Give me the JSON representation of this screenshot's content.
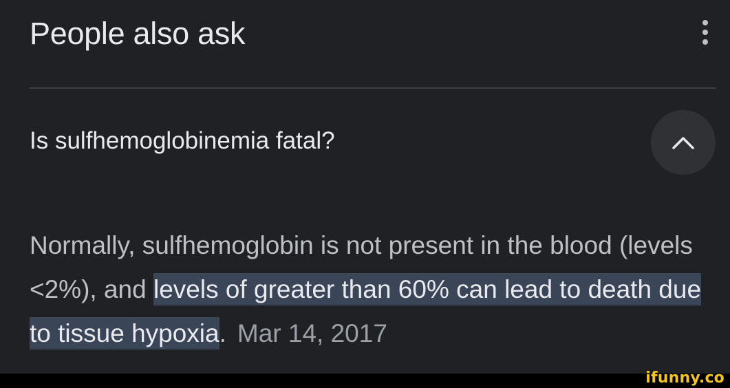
{
  "header": {
    "title": "People also ask",
    "more_icon": "more-vert-icon"
  },
  "question": {
    "text": "Is sulfhemoglobinemia fatal?",
    "toggle_icon": "chevron-up-icon"
  },
  "answer": {
    "text_before": "Normally, sulfhemoglobin is not present in the blood (levels <2%), and ",
    "highlighted": "levels of greater than 60% can lead to death due to tissue hypoxia",
    "text_after": ".",
    "date": "Mar 14, 2017"
  },
  "watermark": {
    "text": "ifunny.co"
  },
  "colors": {
    "background": "#202124",
    "highlight": "#3b4558",
    "watermark": "#f5c518"
  }
}
